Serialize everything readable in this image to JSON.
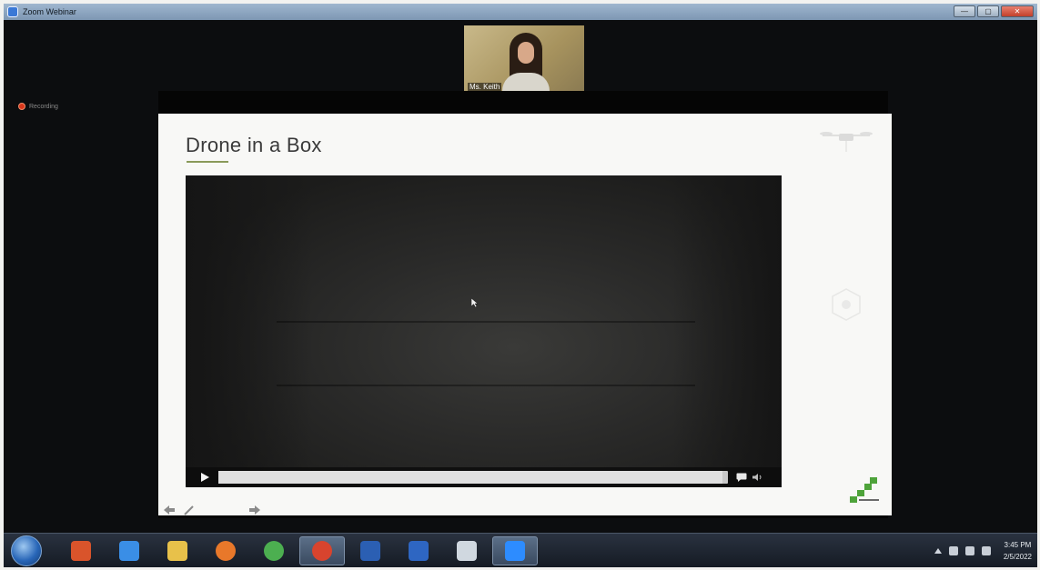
{
  "window": {
    "title": "Zoom Webinar",
    "min": "—",
    "max": "▢",
    "close": "✕"
  },
  "video_thumbnail": {
    "participant_name": "Ms. Keith"
  },
  "recording": {
    "label": "Recording"
  },
  "slide": {
    "title": "Drone in a Box",
    "accent_color": "#8a9a5a"
  },
  "player": {
    "progress": 0.99
  },
  "taskbar": {
    "apps": [
      {
        "name": "media-player",
        "color": "#d9542b"
      },
      {
        "name": "internet-explorer",
        "color": "#3a8ee6"
      },
      {
        "name": "file-explorer",
        "color": "#e8c14a"
      },
      {
        "name": "firefox",
        "color": "#e8782a"
      },
      {
        "name": "chrome",
        "color": "#4caf50"
      },
      {
        "name": "chrome-active",
        "color": "#d8442e"
      },
      {
        "name": "word-doc",
        "color": "#2b5fb3"
      },
      {
        "name": "word",
        "color": "#2e66c2"
      },
      {
        "name": "paint",
        "color": "#d0d8e0"
      },
      {
        "name": "zoom",
        "color": "#2d8cff"
      }
    ],
    "clock_time": "3:45 PM",
    "clock_date": "2/5/2022"
  }
}
